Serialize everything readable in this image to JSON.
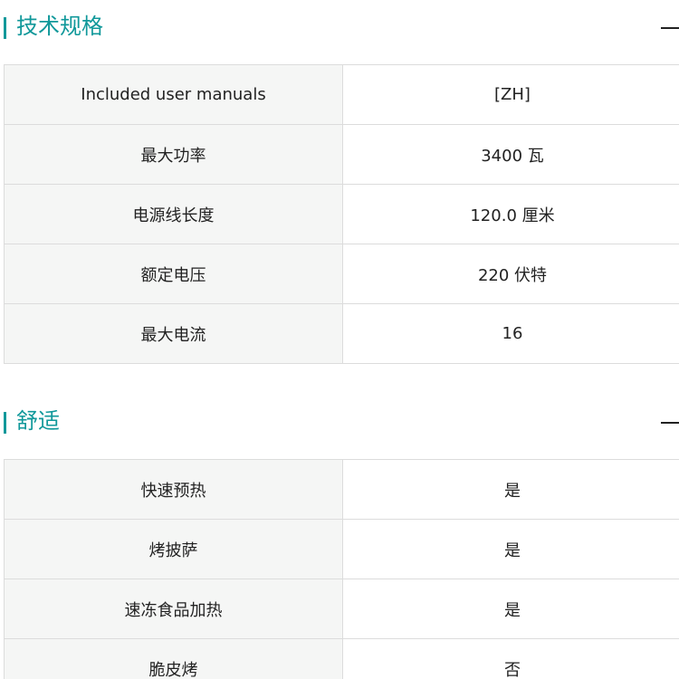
{
  "sections": [
    {
      "title": "技术规格",
      "collapse_icon": "minus-icon",
      "rows": [
        {
          "label": "Included user manuals",
          "value": "[ZH]"
        },
        {
          "label": "最大功率",
          "value": "3400 瓦"
        },
        {
          "label": "电源线长度",
          "value": "120.0 厘米"
        },
        {
          "label": "额定电压",
          "value": "220 伏特"
        },
        {
          "label": "最大电流",
          "value": "16"
        }
      ]
    },
    {
      "title": "舒适",
      "collapse_icon": "minus-icon",
      "rows": [
        {
          "label": "快速预热",
          "value": "是"
        },
        {
          "label": "烤披萨",
          "value": "是"
        },
        {
          "label": "速冻食品加热",
          "value": "是"
        },
        {
          "label": "脆皮烤",
          "value": "否"
        }
      ]
    }
  ],
  "colors": {
    "accent": "#10989a",
    "label_bg": "#f5f6f5",
    "border": "#dcdcdc",
    "text": "#222222"
  }
}
